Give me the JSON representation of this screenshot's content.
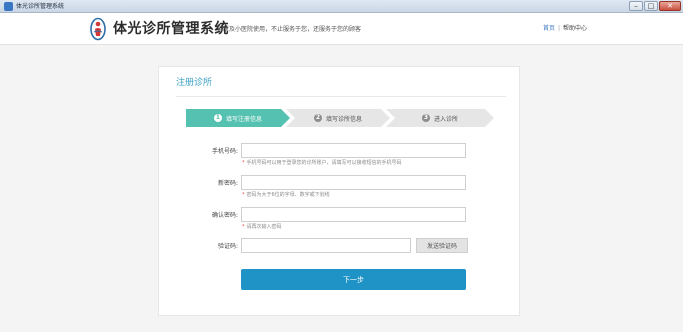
{
  "window": {
    "title": "体光诊所管理系统",
    "buttons": {
      "minimize": "–",
      "maximize": "□",
      "close": "✕"
    }
  },
  "header": {
    "app_name": "体光诊所管理系统",
    "slogan": "诊所及小医院使用，不止服务于您，还服务于您的顾客",
    "links": {
      "home": "首页",
      "separator": "|",
      "help": "帮助中心"
    },
    "logo_icon": "clinic-logo-icon",
    "colors": {
      "link": "#3c7ac1"
    }
  },
  "register": {
    "title": "注册诊所",
    "steps": [
      {
        "num": "1",
        "label": "填写注册信息",
        "active": true
      },
      {
        "num": "2",
        "label": "填写诊所信息",
        "active": false
      },
      {
        "num": "3",
        "label": "进入诊所",
        "active": false
      }
    ],
    "fields": {
      "phone": {
        "label": "手机号码:",
        "value": "",
        "placeholder": "",
        "hint": "手机号码可以用于登录您的诊所账户，请填写可以接收短信的手机号码"
      },
      "password": {
        "label": "新密码:",
        "value": "",
        "placeholder": "",
        "hint": "密码为大于6位的字母、数字或下划线"
      },
      "confirm": {
        "label": "确认密码:",
        "value": "",
        "placeholder": "",
        "hint": "请再次输入密码"
      },
      "code": {
        "label": "验证码:",
        "value": "",
        "placeholder": ""
      }
    },
    "sms_button": "发送验证码",
    "next_button": "下一步",
    "hint_star": "*",
    "colors": {
      "active_step": "#55c1b0",
      "primary": "#1f93c6",
      "title": "#3aa0c5"
    }
  }
}
